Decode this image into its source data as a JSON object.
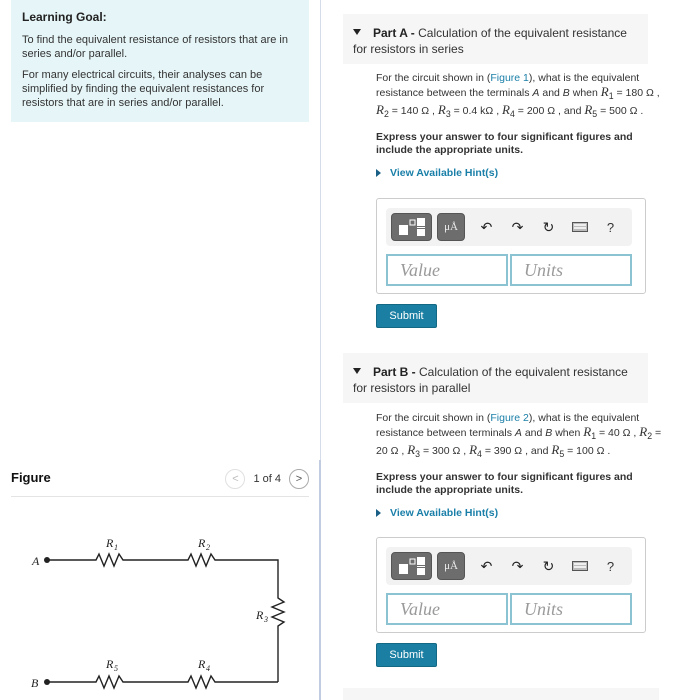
{
  "learning_goal": {
    "title": "Learning Goal:",
    "paragraphs": [
      "To find the equivalent resistance of resistors that are in series and/or parallel.",
      "For many electrical circuits, their analyses can be simplified by finding the equivalent resistances for resistors that are in series and/or parallel."
    ]
  },
  "figure": {
    "title": "Figure",
    "pager": {
      "current": 1,
      "total": 4,
      "label": "1 of 4",
      "prev_icon": "chevron-left-icon",
      "next_icon": "chevron-right-icon"
    },
    "circuit": {
      "terminals": [
        "A",
        "B"
      ],
      "resistors": [
        {
          "label": "R",
          "sub": "1"
        },
        {
          "label": "R",
          "sub": "2"
        },
        {
          "label": "R",
          "sub": "3"
        },
        {
          "label": "R",
          "sub": "4"
        },
        {
          "label": "R",
          "sub": "5"
        }
      ]
    }
  },
  "parts": [
    {
      "id": "A",
      "header_bold": "Part A - ",
      "header_text": "Calculation of the equivalent resistance for resistors in series",
      "question": {
        "pre": "For the circuit shown in (",
        "link": "Figure 1",
        "post": "), what is the equivalent resistance between the terminals ",
        "a": "A",
        "and": " and ",
        "b": "B",
        "when": " when ",
        "values": [
          {
            "name": "R",
            "sub": "1",
            "value": " = 180 Ω"
          },
          {
            "name": "R",
            "sub": "2",
            "value": " = 140 Ω"
          },
          {
            "name": "R",
            "sub": "3",
            "value": " = 0.4 kΩ"
          },
          {
            "name": "R",
            "sub": "4",
            "value": " = 200 Ω"
          },
          {
            "name": "R",
            "sub": "5",
            "value": " = 500 Ω"
          }
        ]
      },
      "instructions": "Express your answer to four significant figures and include the appropriate units.",
      "hint_label": "View Available Hint(s)",
      "value_placeholder": "Value",
      "units_placeholder": "Units",
      "submit_label": "Submit"
    },
    {
      "id": "B",
      "header_bold": "Part B - ",
      "header_text": "Calculation of the equivalent resistance for resistors in parallel",
      "question": {
        "pre": "For the circuit shown in (",
        "link": "Figure 2",
        "post": "), what is the equivalent resistance between terminals ",
        "a": "A",
        "and": " and ",
        "b": "B",
        "when": " when ",
        "values": [
          {
            "name": "R",
            "sub": "1",
            "value": " = 40 Ω"
          },
          {
            "name": "R",
            "sub": "2",
            "value": " = 20 Ω"
          },
          {
            "name": "R",
            "sub": "3",
            "value": " = 300 Ω"
          },
          {
            "name": "R",
            "sub": "4",
            "value": " = 390 Ω"
          },
          {
            "name": "R",
            "sub": "5",
            "value": " = 100 Ω"
          }
        ]
      },
      "instructions": "Express your answer to four significant figures and include the appropriate units.",
      "hint_label": "View Available Hint(s)",
      "value_placeholder": "Value",
      "units_placeholder": "Units",
      "submit_label": "Submit"
    }
  ],
  "toolbar": {
    "units_label": "μÅ",
    "help_label": "?",
    "icons": [
      "templates-icon",
      "units-icon",
      "undo-icon",
      "redo-icon",
      "reset-icon",
      "keyboard-icon",
      "help-icon"
    ]
  },
  "colors": {
    "accent": "#1a7fa2",
    "link": "#1a7fa8",
    "goal_bg": "#e6f5f7",
    "input_border": "#8cc3d3"
  }
}
